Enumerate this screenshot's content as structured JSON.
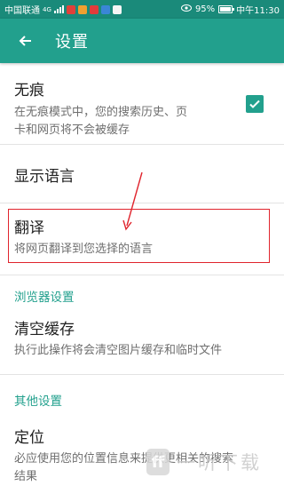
{
  "status_bar": {
    "carrier": "中国联通",
    "network": "4G",
    "battery": "95%",
    "time": "中午11:30",
    "battery_level": 0.95,
    "app_icon_colors": [
      "#e0403a",
      "#f0a030",
      "#e23b3b",
      "#3a86d6",
      "#f5f5f5"
    ]
  },
  "app_bar": {
    "title": "设置",
    "back_icon": "arrow-left-icon",
    "color": "#22a08d"
  },
  "settings": {
    "incognito": {
      "title": "无痕",
      "desc_line1": "在无痕模式中，您的搜索历史、页",
      "desc_line2": "卡和网页将不会被缓存",
      "checked": true
    },
    "language": {
      "title": "显示语言"
    },
    "translate": {
      "title": "翻译",
      "desc": "将网页翻译到您选择的语言"
    },
    "browser_section": {
      "header": "浏览器设置"
    },
    "clear_cache": {
      "title": "清空缓存",
      "desc": "执行此操作将会清空图片缓存和临时文件"
    },
    "other_section": {
      "header": "其他设置"
    },
    "location": {
      "title": "定位",
      "desc_line1": "必应使用您的位置信息来提供更相关的搜索",
      "desc_line2": "结果"
    }
  },
  "watermark": {
    "logo_text": "ff",
    "text": "一听下载"
  },
  "accent_color": "#22a08d",
  "annotation_color": "#e0242d"
}
